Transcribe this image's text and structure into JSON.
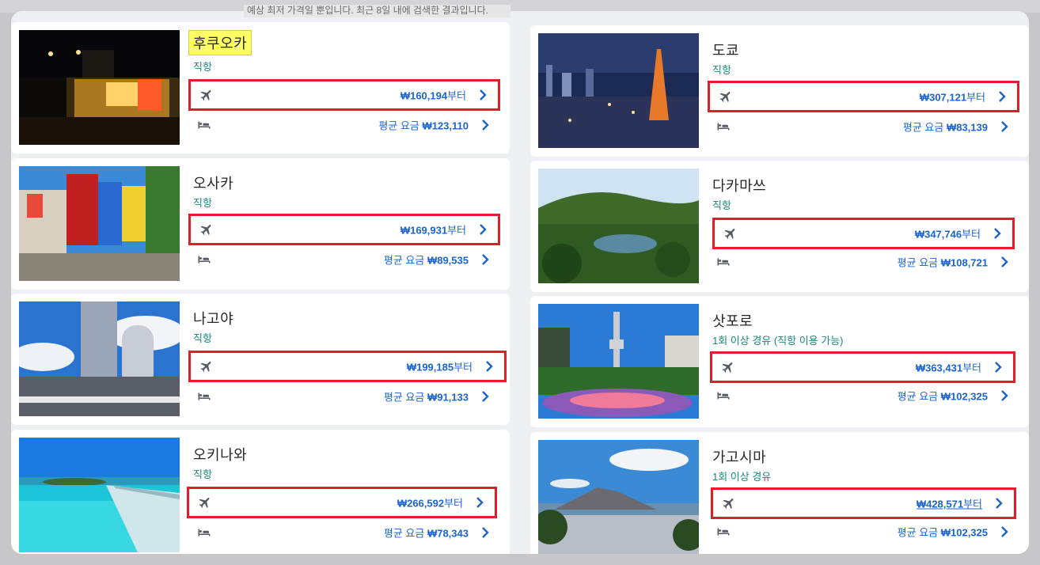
{
  "notice": "예상 최저 가격일 뿐입니다. 최근 8일 내에 검색한 결과입니다.",
  "cards": [
    {
      "city": "후쿠오카",
      "route": "직항",
      "flight_price": "₩160,194",
      "hotel_label": "평균 요금",
      "hotel_price": "₩123,110"
    },
    {
      "city": "도쿄",
      "route": "직항",
      "flight_price": "₩307,121",
      "hotel_label": "평균 요금",
      "hotel_price": "₩83,139"
    },
    {
      "city": "오사카",
      "route": "직항",
      "flight_price": "₩169,931",
      "hotel_label": "평균 요금",
      "hotel_price": "₩89,535"
    },
    {
      "city": "다카마쓰",
      "route": "직항",
      "flight_price": "₩347,746",
      "hotel_label": "평균 요금",
      "hotel_price": "₩108,721"
    },
    {
      "city": "나고야",
      "route": "직항",
      "flight_price": "₩199,185",
      "hotel_label": "평균 요금",
      "hotel_price": "₩91,133"
    },
    {
      "city": "삿포로",
      "route": "1회 이상 경유 (직항 이용 가능)",
      "flight_price": "₩363,431",
      "hotel_label": "평균 요금",
      "hotel_price": "₩102,325"
    },
    {
      "city": "오키나와",
      "route": "직항",
      "flight_price": "₩266,592",
      "hotel_label": "평균 요금",
      "hotel_price": "₩78,343"
    },
    {
      "city": "가고시마",
      "route": "1회 이상 경유",
      "flight_price": "₩428,571",
      "hotel_label": "평균 요금",
      "hotel_price": "₩102,325"
    }
  ],
  "price_suffix": "부터",
  "icons": {
    "flight": "airplane-icon",
    "hotel": "bed-icon",
    "more": "chevron-right-icon"
  },
  "colors": {
    "price": "#1b64d0",
    "route": "#1a8a7a",
    "highlight_box": "#e11d2a",
    "city_highlight": "#ffff66"
  }
}
